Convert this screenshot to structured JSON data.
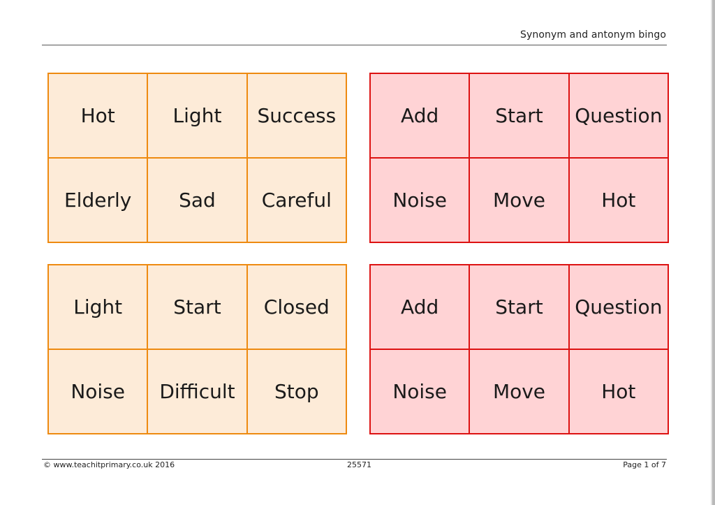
{
  "header": {
    "title": "Synonym and antonym bingo"
  },
  "footer": {
    "copyright": "© www.teachitprimary.co.uk 2016",
    "resource_id": "25571",
    "page": "Page 1 of 7"
  },
  "colors": {
    "orange_border": "#ee8a10",
    "orange_fill": "#fdebd8",
    "red_border": "#dd1212",
    "red_fill": "#ffd3d5"
  },
  "cards": [
    {
      "theme": "orange",
      "words": [
        "Hot",
        "Light",
        "Success",
        "Elderly",
        "Sad",
        "Careful"
      ]
    },
    {
      "theme": "red",
      "words": [
        "Add",
        "Start",
        "Question",
        "Noise",
        "Move",
        "Hot"
      ]
    },
    {
      "theme": "orange",
      "words": [
        "Light",
        "Start",
        "Closed",
        "Noise",
        "Difficult",
        "Stop"
      ]
    },
    {
      "theme": "red",
      "words": [
        "Add",
        "Start",
        "Question",
        "Noise",
        "Move",
        "Hot"
      ]
    }
  ]
}
